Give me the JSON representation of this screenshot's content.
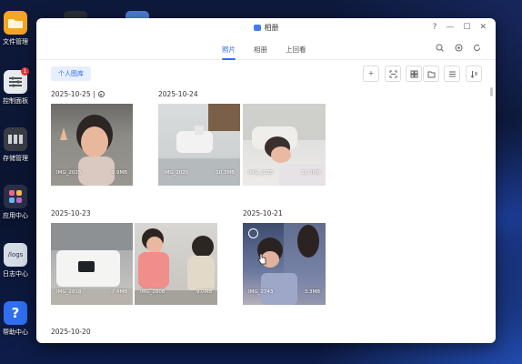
{
  "desktop": {
    "icons": [
      {
        "label": "文件管理",
        "icon": "folder-icon",
        "color": "#f5a623"
      },
      {
        "label": "控制面板",
        "icon": "control-panel-icon",
        "color": "#e9ecef",
        "badge": "1"
      },
      {
        "label": "存储管理",
        "icon": "storage-icon",
        "color": "#3a3d44"
      },
      {
        "label": "应用中心",
        "icon": "app-center-icon",
        "color": "#2b2f45"
      },
      {
        "label": "日志中心",
        "icon": "logs-icon",
        "color": "#d7dde8",
        "tile_text": "/logs"
      },
      {
        "label": "帮助中心",
        "icon": "help-icon",
        "color": "#2f6ff0",
        "tile_text": "?"
      }
    ]
  },
  "window": {
    "title": "相册",
    "controls": [
      "?",
      "—",
      "☐",
      "✕"
    ]
  },
  "tabs": [
    {
      "label": "照片",
      "active": true
    },
    {
      "label": "相册",
      "active": false
    },
    {
      "label": "上回看",
      "active": false
    }
  ],
  "tab_icons": [
    "search-icon",
    "settings-icon",
    "refresh-icon"
  ],
  "toolbar": {
    "album_button": "个人图库",
    "tools": [
      "add-icon",
      "scan-icon",
      "grid-icon",
      "folder-icon",
      "list-icon",
      "sort-icon"
    ]
  },
  "groups": [
    {
      "date": "2025-10-25 |",
      "has_icon": true
    },
    {
      "date": "2025-10-24",
      "has_icon": false
    },
    {
      "date": "2025-10-23",
      "has_icon": false
    },
    {
      "date": "2025-10-21",
      "has_icon": false
    },
    {
      "date": "2025-10-20",
      "has_icon": false
    }
  ],
  "photos": [
    {
      "name": "IMG_2025",
      "size": "9.9MB",
      "group": "2025-10-25"
    },
    {
      "name": "IMG_2025",
      "size": "10.3MB",
      "group": "2025-10-24"
    },
    {
      "name": "IMG_2025",
      "size": "11.3MB",
      "group": "2025-10-24"
    },
    {
      "name": "IMG_2818",
      "size": "7.4MB",
      "group": "2025-10-23"
    },
    {
      "name": "IMG_2808",
      "size": "9.0MB",
      "group": "2025-10-23"
    },
    {
      "name": "IMG_2743",
      "size": "3.3MB",
      "group": "2025-10-21"
    }
  ]
}
